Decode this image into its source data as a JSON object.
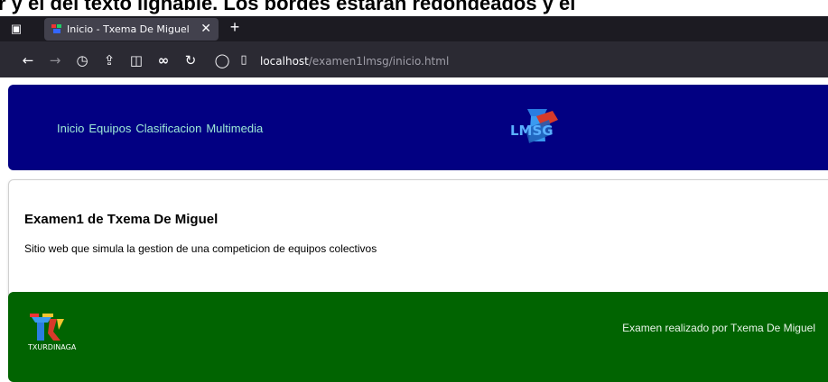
{
  "doc_clip": {
    "text": "r y el del texto lighable. Los bordes estaran redondeados y el"
  },
  "browser": {
    "tab_title": "Inicio - Txema De Miguel",
    "url_host": "localhost",
    "url_path": "/examen1lmsg/inicio.html"
  },
  "header": {
    "menu": [
      "Inicio",
      "Equipos",
      "Clasificacion",
      "Multimedia"
    ],
    "logo_text": "LMSG"
  },
  "main": {
    "title": "Examen1 de Txema De Miguel",
    "description": "Sitio web que simula la gestion de una competicion de equipos colectivos"
  },
  "footer": {
    "logo_text": "TXURDINAGA",
    "credit": "Examen realizado por Txema De Miguel"
  },
  "colors": {
    "header_bg": "#020082",
    "footer_bg": "#016401",
    "menu_link": "#9ee9d6"
  }
}
